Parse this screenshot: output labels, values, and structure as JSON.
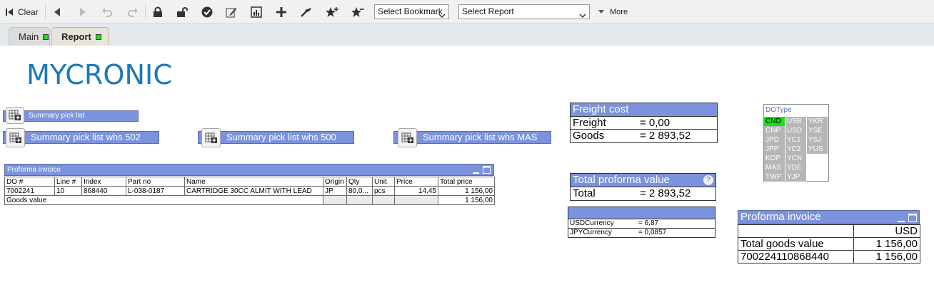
{
  "toolbar": {
    "clear_label": "Clear",
    "bookmark_select": "Select Bookmark",
    "report_select": "Select Report",
    "more_label": "More"
  },
  "tabs": [
    {
      "label": "Main",
      "active": false
    },
    {
      "label": "Report",
      "active": true
    }
  ],
  "logo_text": "MYCRONIC",
  "colors": {
    "header_blue": "#7b93dd",
    "status_green": "#1ed81e",
    "logo_blue": "#1b79b8"
  },
  "buttons": {
    "summary_pick_list": "Summary pick list",
    "summary_502": "Summary pick list whs 502",
    "summary_500": "Summary pick list whs 500",
    "summary_mas": "Summary pick list whs MAS"
  },
  "proforma_invoice": {
    "title": "Proforma invoice",
    "columns": [
      "DO #",
      "Line #",
      "Index",
      "Part no",
      "Name",
      "Origin",
      "Qty",
      "Unit",
      "Price",
      "Total price"
    ],
    "row": {
      "do": "7002241",
      "line": "10",
      "index": "868440",
      "part_no": "L-038-0187",
      "name": "CARTRIDGE 30CC ALMIT WITH LEAD",
      "origin": "JP",
      "qty": "80,0...",
      "unit": "pcs",
      "price": "14,45",
      "total": "1 156,00"
    },
    "goods_label": "Goods value",
    "goods_total": "1 156,00"
  },
  "freight_box": {
    "title": "Freight cost",
    "rows": [
      {
        "label": "Freight",
        "value": "= 0,00"
      },
      {
        "label": "Goods",
        "value": "= 2 893,52"
      }
    ]
  },
  "total_box": {
    "title": "Total proforma value",
    "help": "?",
    "label": "Total",
    "value": "= 2 893,52"
  },
  "currency_box": {
    "rows": [
      {
        "label": "USDCurrency",
        "value": "= 6,87"
      },
      {
        "label": "JPYCurrency",
        "value": "= 0,0857"
      }
    ]
  },
  "dotype": {
    "title": "DOType",
    "col1": [
      "CND",
      "CNP",
      "JPD",
      "JPP",
      "KOP",
      "MAS",
      "TWP"
    ],
    "col2": [
      "USB",
      "USD",
      "YC1",
      "YC2",
      "YCN",
      "YDE",
      "YJP"
    ],
    "col3": [
      "YKR",
      "YSE",
      "YSJ",
      "YUS"
    ],
    "selected": "CND"
  },
  "right_proforma": {
    "title": "Proforma invoice",
    "currency": "USD",
    "rows": [
      {
        "label": "Total goods value",
        "value": "1 156,00"
      },
      {
        "label": "700224110868440",
        "value": "1 156,00"
      }
    ]
  }
}
